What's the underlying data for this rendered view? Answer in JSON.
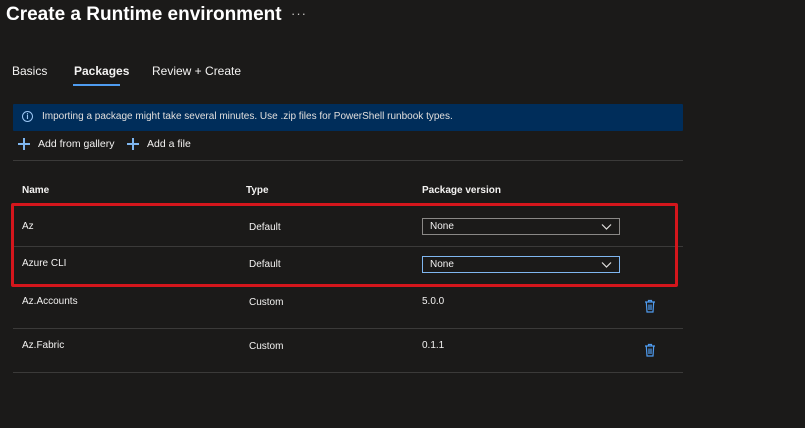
{
  "page": {
    "title": "Create a Runtime environment",
    "more_icon": "ellipsis-icon"
  },
  "tabs": [
    {
      "label": "Basics",
      "active": false
    },
    {
      "label": "Packages",
      "active": true
    },
    {
      "label": "Review + Create",
      "active": false
    }
  ],
  "banner": {
    "icon": "info-icon",
    "text": "Importing a package might take several minutes. Use .zip files for PowerShell runbook types."
  },
  "toolbar": {
    "add_from_gallery": "Add from gallery",
    "add_file": "Add a file",
    "icon": "plus-icon"
  },
  "table": {
    "columns": [
      "Name",
      "Type",
      "Package version"
    ],
    "rows": [
      {
        "name": "Az",
        "type": "Default",
        "version": "None",
        "control": "dropdown"
      },
      {
        "name": "Azure CLI",
        "type": "Default",
        "version": "None",
        "control": "dropdown"
      },
      {
        "name": "Az.Accounts",
        "type": "Custom",
        "version": "5.0.0",
        "control": "text"
      },
      {
        "name": "Az.Fabric",
        "type": "Custom",
        "version": "0.1.1",
        "control": "text"
      }
    ]
  },
  "colors": {
    "accent": "#4f9cf0",
    "banner_bg": "#002d5a",
    "highlight": "#d4161c",
    "background": "#1b1a19"
  }
}
